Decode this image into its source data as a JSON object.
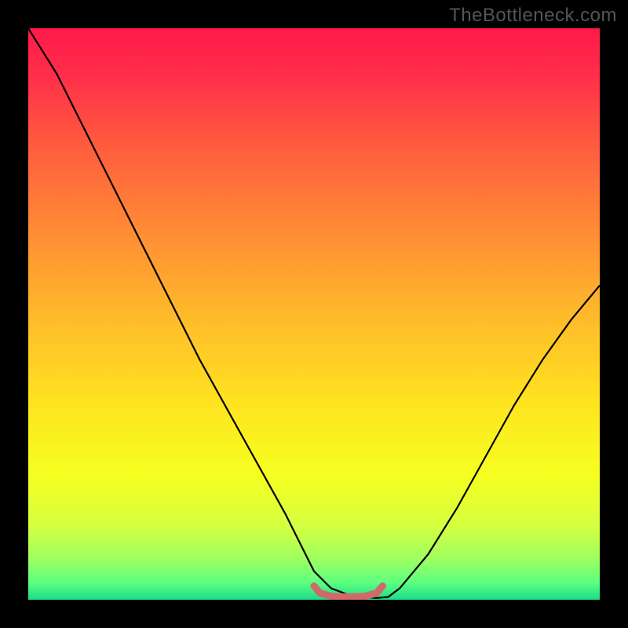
{
  "watermark": "TheBottleneck.com",
  "chart_data": {
    "type": "line",
    "title": "",
    "xlabel": "",
    "ylabel": "",
    "xlim": [
      0,
      100
    ],
    "ylim": [
      0,
      100
    ],
    "background_gradient": {
      "stops": [
        {
          "offset": 0.0,
          "color": "#ff1a4a"
        },
        {
          "offset": 0.08,
          "color": "#ff2d4a"
        },
        {
          "offset": 0.2,
          "color": "#ff5a3e"
        },
        {
          "offset": 0.35,
          "color": "#ff8a36"
        },
        {
          "offset": 0.5,
          "color": "#ffb92a"
        },
        {
          "offset": 0.65,
          "color": "#ffe220"
        },
        {
          "offset": 0.78,
          "color": "#f6ff20"
        },
        {
          "offset": 0.87,
          "color": "#d6ff40"
        },
        {
          "offset": 0.93,
          "color": "#9cff60"
        },
        {
          "offset": 0.97,
          "color": "#5cff80"
        },
        {
          "offset": 1.0,
          "color": "#1cdc8a"
        }
      ]
    },
    "series": [
      {
        "name": "bottleneck-curve",
        "color": "#000000",
        "x": [
          0,
          5,
          10,
          15,
          20,
          25,
          30,
          35,
          40,
          45,
          48,
          50,
          53,
          57,
          61,
          63,
          65,
          70,
          75,
          80,
          85,
          90,
          95,
          100
        ],
        "y": [
          100,
          92,
          82,
          72,
          62,
          52,
          42,
          33,
          24,
          15,
          9,
          5,
          2,
          0.5,
          0.3,
          0.5,
          2,
          8,
          16,
          25,
          34,
          42,
          49,
          55
        ]
      },
      {
        "name": "optimal-band-marker",
        "color": "#cf6a6a",
        "x": [
          50,
          51,
          53,
          56,
          59,
          61,
          62
        ],
        "y": [
          2.4,
          1.2,
          0.6,
          0.5,
          0.6,
          1.2,
          2.4
        ]
      }
    ]
  }
}
